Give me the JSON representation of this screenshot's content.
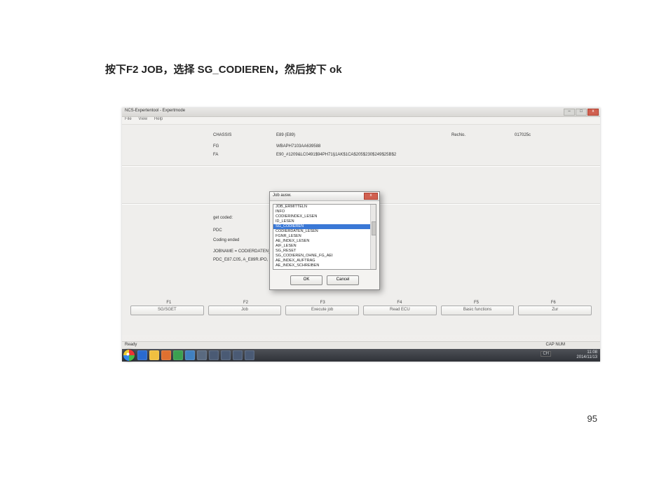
{
  "instruction": "按下F2 JOB，选择 SG_CODIEREN，然后按下 ok",
  "page_number": "95",
  "window": {
    "title": "NCS-Expertentool - Expertmode",
    "menu": [
      "File",
      "View",
      "Help"
    ],
    "buttons": {
      "min": "–",
      "max": "□",
      "close": "x"
    }
  },
  "fields": {
    "chassis_label": "CHASSIS",
    "chassis_value": "E89 (E89)",
    "fg_label": "FG",
    "fg_value": "WBAPH7103AA639588",
    "fa_label": "FA",
    "fa_value": "E90_#1209&LC0491$94PH71§1AK$1CA$205$230$249$25B$2",
    "recno_label": "RecNo.",
    "recno_value": "017025c",
    "get_coded": "get coded:",
    "ecu": "PDC",
    "coding_ended": "Coding ended",
    "jobname": "JOBNAME = CODIERDATEN_LESEN",
    "prg": "PDC_E87.C05, A_E89R.IPO, PDC_87.PRG"
  },
  "dialog": {
    "title": "Job ausw.",
    "close": "x",
    "options": [
      "JOB_ERMITTELN",
      "INFO",
      "CODIERINDEX_LESEN",
      "ID_LESEN",
      "SG_CODIEREN",
      "CODIERDATEN_LESEN",
      "FGNR_LESEN",
      "AE_INDEX_LESEN",
      "AIF_LESEN",
      "SG_RESET",
      "SG_CODIEREN_OHNE_FG_AEI",
      "AE_INDEX_AUFTRAG",
      "AE_INDEX_SCHREIBEN"
    ],
    "selected_index": 4,
    "ok": "OK",
    "cancel": "Cancel"
  },
  "fkeys": {
    "labels": [
      "F1",
      "F2",
      "F3",
      "F4",
      "F5",
      "F6"
    ],
    "buttons": [
      "SG/SGET",
      "Job",
      "Execute job",
      "Read ECU",
      "Basic functions",
      "Zur"
    ]
  },
  "status": {
    "left": "Ready",
    "right": "CAP NUM"
  },
  "taskbar": {
    "lang": "CH",
    "time": "11:08",
    "date": "2014/11/13"
  }
}
